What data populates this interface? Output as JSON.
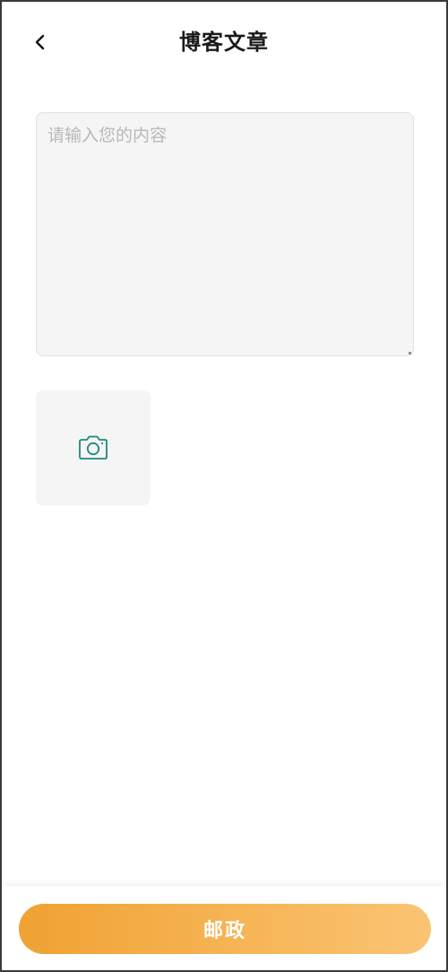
{
  "header": {
    "title": "博客文章"
  },
  "editor": {
    "value": "",
    "placeholder": "请输入您的内容"
  },
  "upload": {
    "icon": "camera-icon",
    "icon_color": "#1a8a7c"
  },
  "footer": {
    "submit_label": "邮政",
    "gradient_start": "#f0a232",
    "gradient_end": "#fbc473"
  }
}
